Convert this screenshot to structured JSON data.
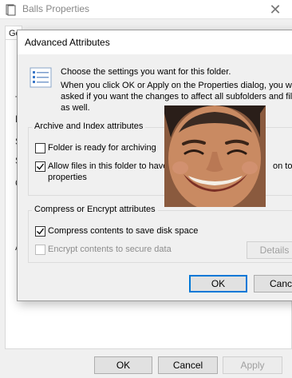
{
  "properties_window": {
    "title": "Balls Properties",
    "close_glyph": "✕",
    "tab_label": "Ge",
    "left_peek_letters": [
      "T",
      "L",
      "S",
      "S",
      "C",
      "A"
    ],
    "buttons": {
      "ok": "OK",
      "cancel": "Cancel",
      "apply": "Apply"
    }
  },
  "dialog": {
    "title": "Advanced Attributes",
    "intro_line1": "Choose the settings you want for this folder.",
    "intro_line2": "When you click OK or Apply on the Properties dialog, you will",
    "intro_line3": "asked if you want the changes to affect all subfolders and fil",
    "intro_line4": "as well.",
    "archive_group": {
      "label": "Archive and Index attributes",
      "archiving_label": "Folder is ready for archiving",
      "archiving_checked": false,
      "index_label_line1": "Allow files in this folder to have",
      "index_label_tail": "on to f",
      "index_label_line2": "properties",
      "index_checked": true
    },
    "compress_group": {
      "label": "Compress or Encrypt attributes",
      "compress_label": "Compress contents to save disk space",
      "compress_checked": true,
      "encrypt_label": "Encrypt contents to secure data",
      "encrypt_checked": false,
      "details_label": "Details"
    },
    "buttons": {
      "ok": "OK",
      "cancel": "Cance"
    }
  },
  "overlay": {
    "icon": "smiling-face-photo"
  },
  "colors": {
    "accent": "#0078d7",
    "disabled_text": "#8d8d8d",
    "background": "#f0f0f0"
  }
}
